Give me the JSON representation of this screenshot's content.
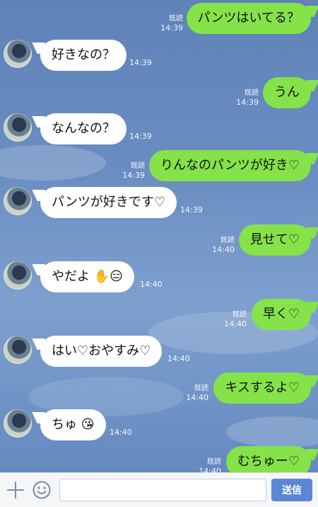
{
  "read_label": "既読",
  "messages": [
    {
      "side": "out",
      "text": "パンツはいてる？",
      "time": "14:39"
    },
    {
      "side": "in",
      "text": "好きなの？",
      "time": "14:39"
    },
    {
      "side": "out",
      "text": "うん",
      "time": "14:39"
    },
    {
      "side": "in",
      "text": "なんなの？",
      "time": "14:39"
    },
    {
      "side": "out",
      "text": "りんなのパンツが好き♡",
      "time": "14:39"
    },
    {
      "side": "in",
      "text": "パンツが好きです♡",
      "time": "14:39"
    },
    {
      "side": "out",
      "text": "見せて♡",
      "time": "14:40"
    },
    {
      "side": "in",
      "text": "やだよ ✋😑",
      "time": "14:40"
    },
    {
      "side": "out",
      "text": "早く♡",
      "time": "14:40"
    },
    {
      "side": "in",
      "text": "はい♡おやすみ♡",
      "time": "14:40"
    },
    {
      "side": "out",
      "text": "キスするよ♡",
      "time": "14:40"
    },
    {
      "side": "in",
      "text": "ちゅ 😘",
      "time": "14:40"
    },
    {
      "side": "out",
      "text": "むちゅー♡",
      "time": "14:40"
    }
  ],
  "input_bar": {
    "message_placeholder": "",
    "send_label": "送信"
  },
  "colors": {
    "outgoing_bubble": "#85e249",
    "incoming_bubble": "#ffffff",
    "send_button": "#5b86d6"
  }
}
